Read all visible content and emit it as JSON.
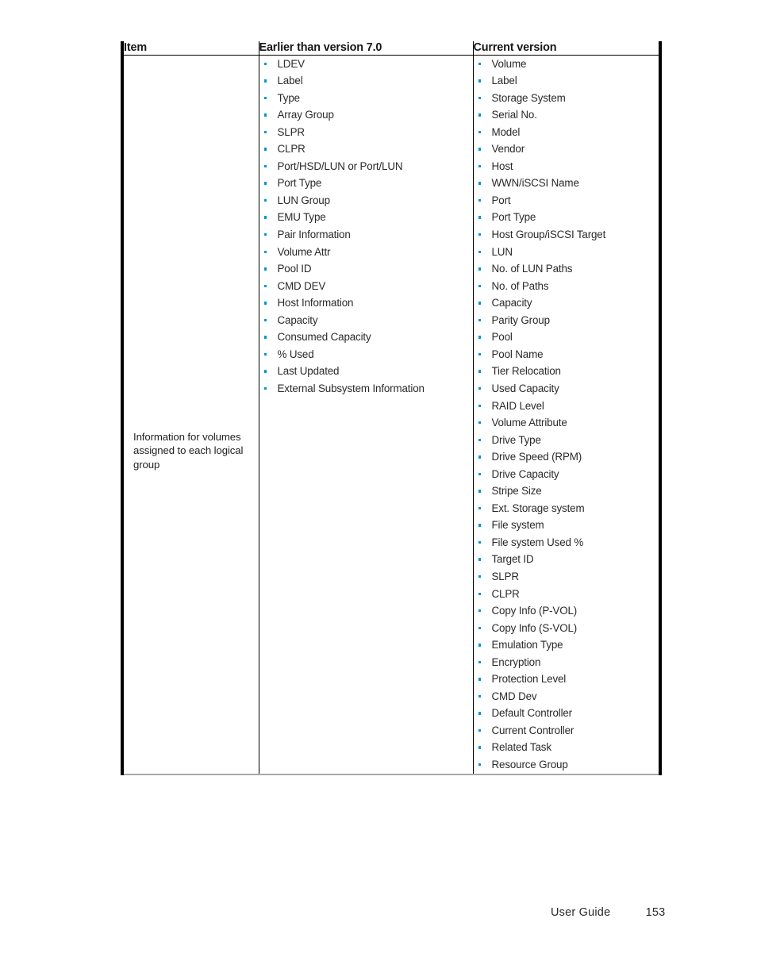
{
  "document": {
    "page_number": "153",
    "footer_label": "User Guide"
  },
  "table": {
    "headers": {
      "item": "Item",
      "earlier": "Earlier than version 7.0",
      "current": "Current version"
    },
    "row": {
      "item_label": "Information for volumes assigned to each logical group",
      "earlier_items": [
        "LDEV",
        "Label",
        "Type",
        "Array Group",
        "SLPR",
        "CLPR",
        "Port/HSD/LUN or Port/LUN",
        "Port Type",
        "LUN Group",
        "EMU Type",
        "Pair Information",
        "Volume Attr",
        "Pool ID",
        "CMD DEV",
        "Host Information",
        "Capacity",
        "Consumed Capacity",
        "% Used",
        "Last Updated",
        "External Subsystem Information"
      ],
      "current_items": [
        "Volume",
        "Label",
        "Storage System",
        "Serial No.",
        "Model",
        "Vendor",
        "Host",
        "WWN/iSCSI Name",
        "Port",
        "Port Type",
        "Host Group/iSCSI Target",
        "LUN",
        "No. of LUN Paths",
        "No. of Paths",
        "Capacity",
        "Parity Group",
        "Pool",
        "Pool Name",
        "Tier Relocation",
        "Used Capacity",
        "RAID Level",
        "Volume Attribute",
        "Drive Type",
        "Drive Speed (RPM)",
        "Drive Capacity",
        "Stripe Size",
        "Ext. Storage system",
        "File system",
        "File system Used %",
        "Target ID",
        "SLPR",
        "CLPR",
        "Copy Info (P-VOL)",
        "Copy Info (S-VOL)",
        "Emulation Type",
        "Encryption",
        "Protection Level",
        "CMD Dev",
        "Default Controller",
        "Current Controller",
        "Related Task",
        "Resource Group"
      ]
    }
  },
  "colors": {
    "bullet": "#0096d6",
    "text": "#2a2a2a",
    "border_outer": "#000000",
    "border_bottom": "#a8a8a8"
  }
}
